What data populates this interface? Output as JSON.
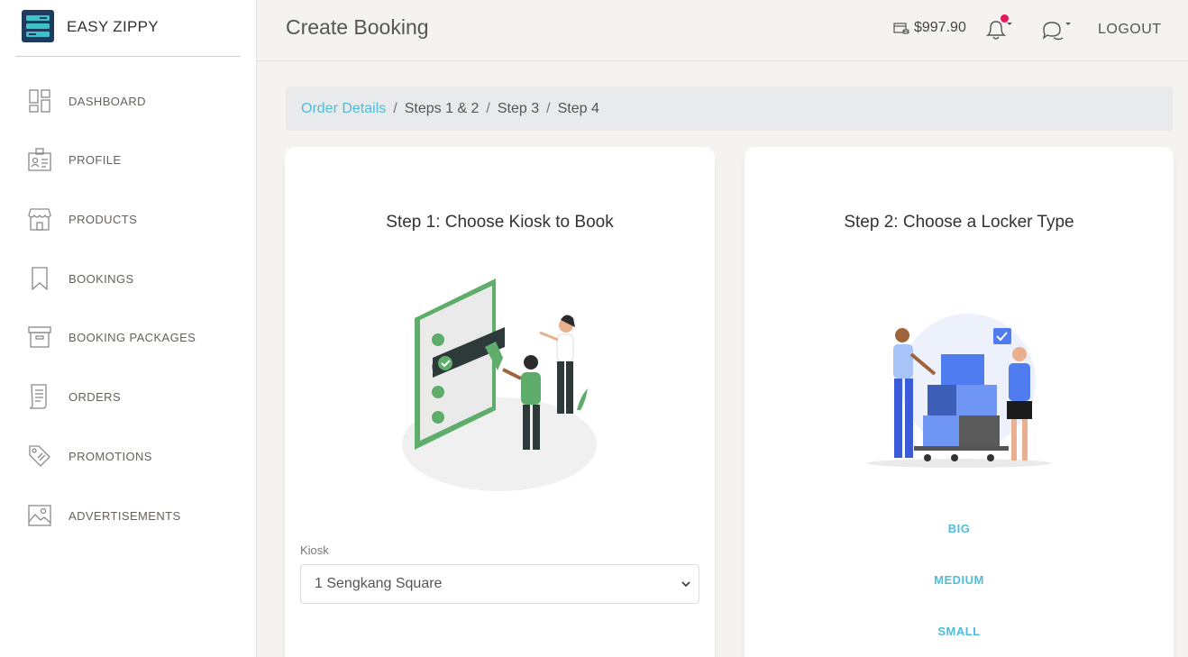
{
  "brand": {
    "name": "EASY ZIPPY"
  },
  "sidebar": {
    "items": [
      {
        "label": "DASHBOARD",
        "icon": "dashboard-icon"
      },
      {
        "label": "PROFILE",
        "icon": "profile-card-icon"
      },
      {
        "label": "PRODUCTS",
        "icon": "store-icon"
      },
      {
        "label": "BOOKINGS",
        "icon": "bookmark-icon"
      },
      {
        "label": "BOOKING PACKAGES",
        "icon": "archive-box-icon"
      },
      {
        "label": "ORDERS",
        "icon": "receipt-icon"
      },
      {
        "label": "PROMOTIONS",
        "icon": "tag-icon"
      },
      {
        "label": "ADVERTISEMENTS",
        "icon": "image-icon"
      }
    ]
  },
  "header": {
    "title": "Create Booking",
    "wallet_amount": "$997.90",
    "logout_label": "LOGOUT"
  },
  "breadcrumb": {
    "link": "Order Details",
    "steps": [
      "Steps 1 & 2",
      "Step 3",
      "Step 4"
    ],
    "separator": "/"
  },
  "step1": {
    "title": "Step 1: Choose Kiosk to Book",
    "kiosk_label": "Kiosk",
    "kiosk_value": "1 Sengkang Square"
  },
  "step2": {
    "title": "Step 2: Choose a Locker Type",
    "options": [
      "BIG",
      "MEDIUM",
      "SMALL"
    ]
  },
  "colors": {
    "accent": "#51bcda",
    "brand_green": "#5fad6b",
    "brand_blue": "#4f7df0",
    "notification_dot": "#e8175d"
  }
}
